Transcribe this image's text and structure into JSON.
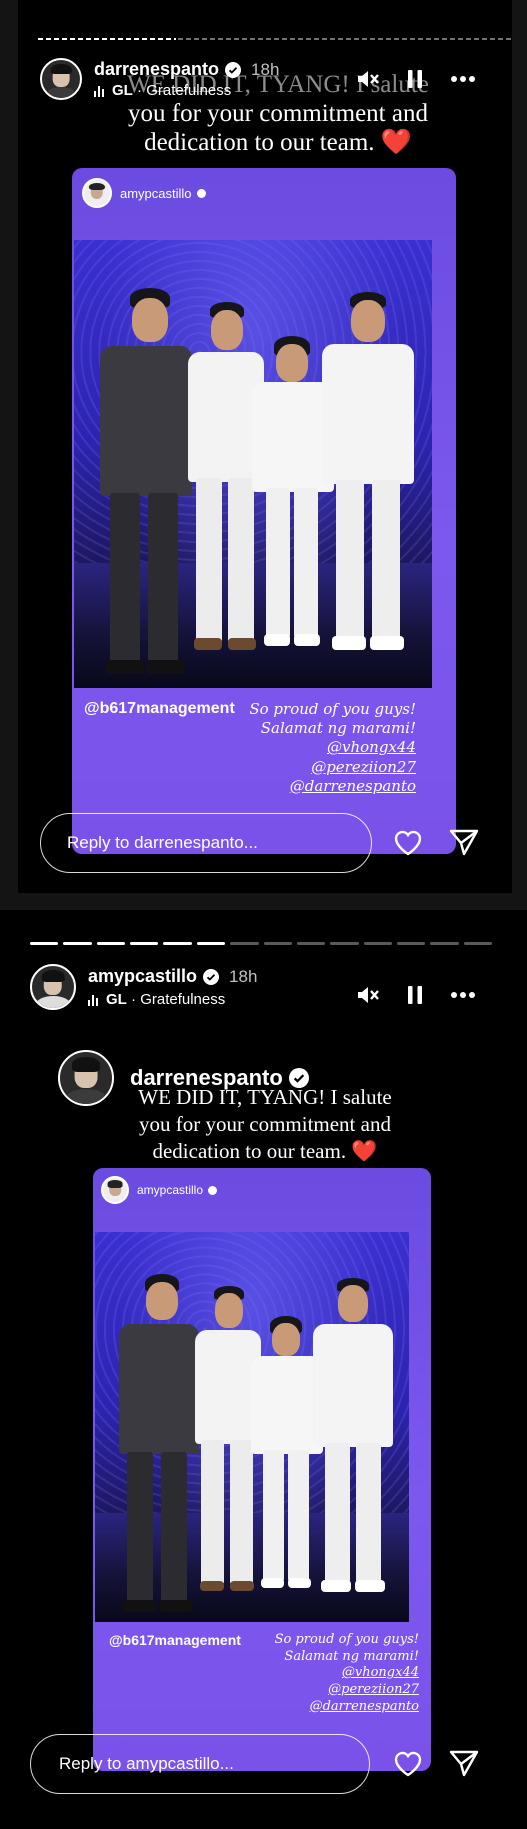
{
  "story1": {
    "username": "darrenespanto",
    "time": "18h",
    "music_artist": "GL",
    "music_title": "Gratefulness",
    "caption_lines": [
      "WE DID IT, TYANG! I salute",
      "you for your commitment and",
      "dedication to our team. ❤️"
    ],
    "shared_card": {
      "username": "amypcastillo",
      "tag": "@b617management",
      "lines": [
        "So proud of you guys!",
        "Salamat ng marami!",
        "@vhongx44",
        "@pereziion27",
        "@darrenespanto"
      ]
    },
    "reply_placeholder": "Reply to darrenespanto..."
  },
  "story2": {
    "username": "amypcastillo",
    "time": "18h",
    "music_artist": "GL",
    "music_title": "Gratefulness",
    "reshare_username": "darrenespanto",
    "caption_lines": [
      "WE DID IT, TYANG! I salute",
      "you for your commitment and",
      "dedication to our team. ❤️"
    ],
    "shared_card": {
      "username": "amypcastillo",
      "tag": "@b617management",
      "lines": [
        "So proud of you guys!",
        "Salamat ng marami!",
        "@vhongx44",
        "@pereziion27",
        "@darrenespanto"
      ]
    },
    "reply_placeholder": "Reply to amypcastillo..."
  },
  "icons": [
    "verified-icon",
    "muted-speaker-icon",
    "pause-icon",
    "more-icon",
    "heart-icon",
    "send-icon",
    "music-bars-icon"
  ]
}
